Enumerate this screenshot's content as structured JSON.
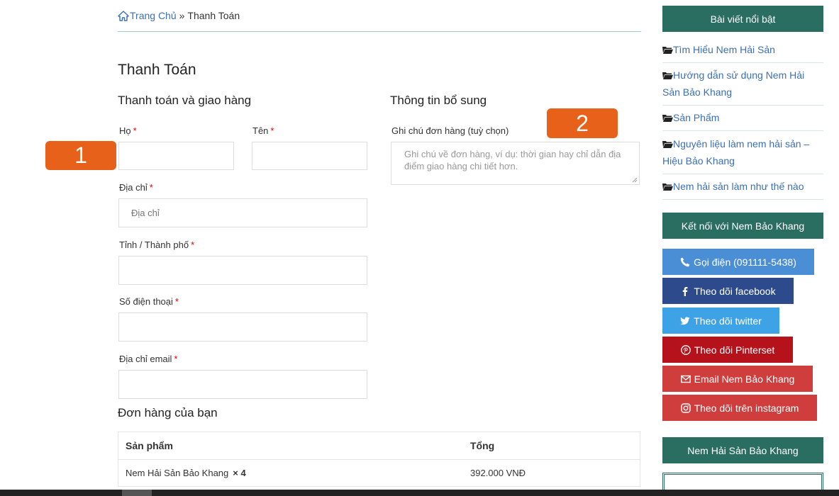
{
  "breadcrumb": {
    "home": "Trang Chủ",
    "separator": "»",
    "current": "Thanh Toán"
  },
  "page_title": "Thanh Toán",
  "billing": {
    "title": "Thanh toán và giao hàng",
    "first_name": {
      "label": "Họ",
      "required": "*",
      "value": ""
    },
    "last_name": {
      "label": "Tên",
      "required": "*",
      "value": ""
    },
    "address": {
      "label": "Địa chỉ",
      "required": "*",
      "placeholder": "Địa chỉ"
    },
    "city": {
      "label": "Tỉnh / Thành phố",
      "required": "*",
      "value": ""
    },
    "phone": {
      "label": "Số điện thoại",
      "required": "*",
      "value": ""
    },
    "email": {
      "label": "Địa chỉ email",
      "required": "*",
      "value": ""
    }
  },
  "additional": {
    "title": "Thông tin bổ sung",
    "notes_label": "Ghi chú đơn hàng (tuỳ chọn)",
    "notes_placeholder": "Ghi chú về đơn hàng, ví dụ: thời gian hay chỉ dẫn địa điểm giao hàng chi tiết hơn."
  },
  "annotations": {
    "badge1": "1",
    "badge2": "2"
  },
  "order": {
    "title": "Đơn hàng của bạn",
    "col_product": "Sản phẩm",
    "col_total": "Tổng",
    "items": [
      {
        "name": "Nem Hải Sản Bảo Khang",
        "qty": "× 4",
        "total": "392.000 VNĐ"
      }
    ]
  },
  "sidebar": {
    "featured_title": "Bài viết nổi bật",
    "posts": [
      "Tìm Hiểu Nem Hải Sản",
      "Hướng dẫn sử dụng Nem Hải Sản Bảo Khang",
      "Sản Phẩm",
      "Nguyên liệu làm nem hải sản – Hiệu Bảo Khang",
      "Nem hải sản làm như thế nào"
    ],
    "connect_title": "Kết nối với Nem Bảo Khang",
    "buttons": {
      "call": "Gọi điện (091111-5438)",
      "facebook": "Theo dõi facebook",
      "twitter": "Theo dõi twitter",
      "pinterest": "Theo dõi Pinterset",
      "email": "Email Nem Bảo Khang",
      "instagram": "Theo dõi trên instagram"
    },
    "brand_title": "Nem Hải Sản Bảo Khang"
  },
  "colors": {
    "widget_green": "#2a6e62",
    "link_blue": "#3b6fb6",
    "badge_orange": "#e8611a",
    "call": "#4a8fd6",
    "facebook": "#2d4a8c",
    "twitter": "#3ea3e6",
    "pinterest": "#b5121b",
    "email": "#cf3d3d",
    "instagram": "#cf3d3d"
  }
}
